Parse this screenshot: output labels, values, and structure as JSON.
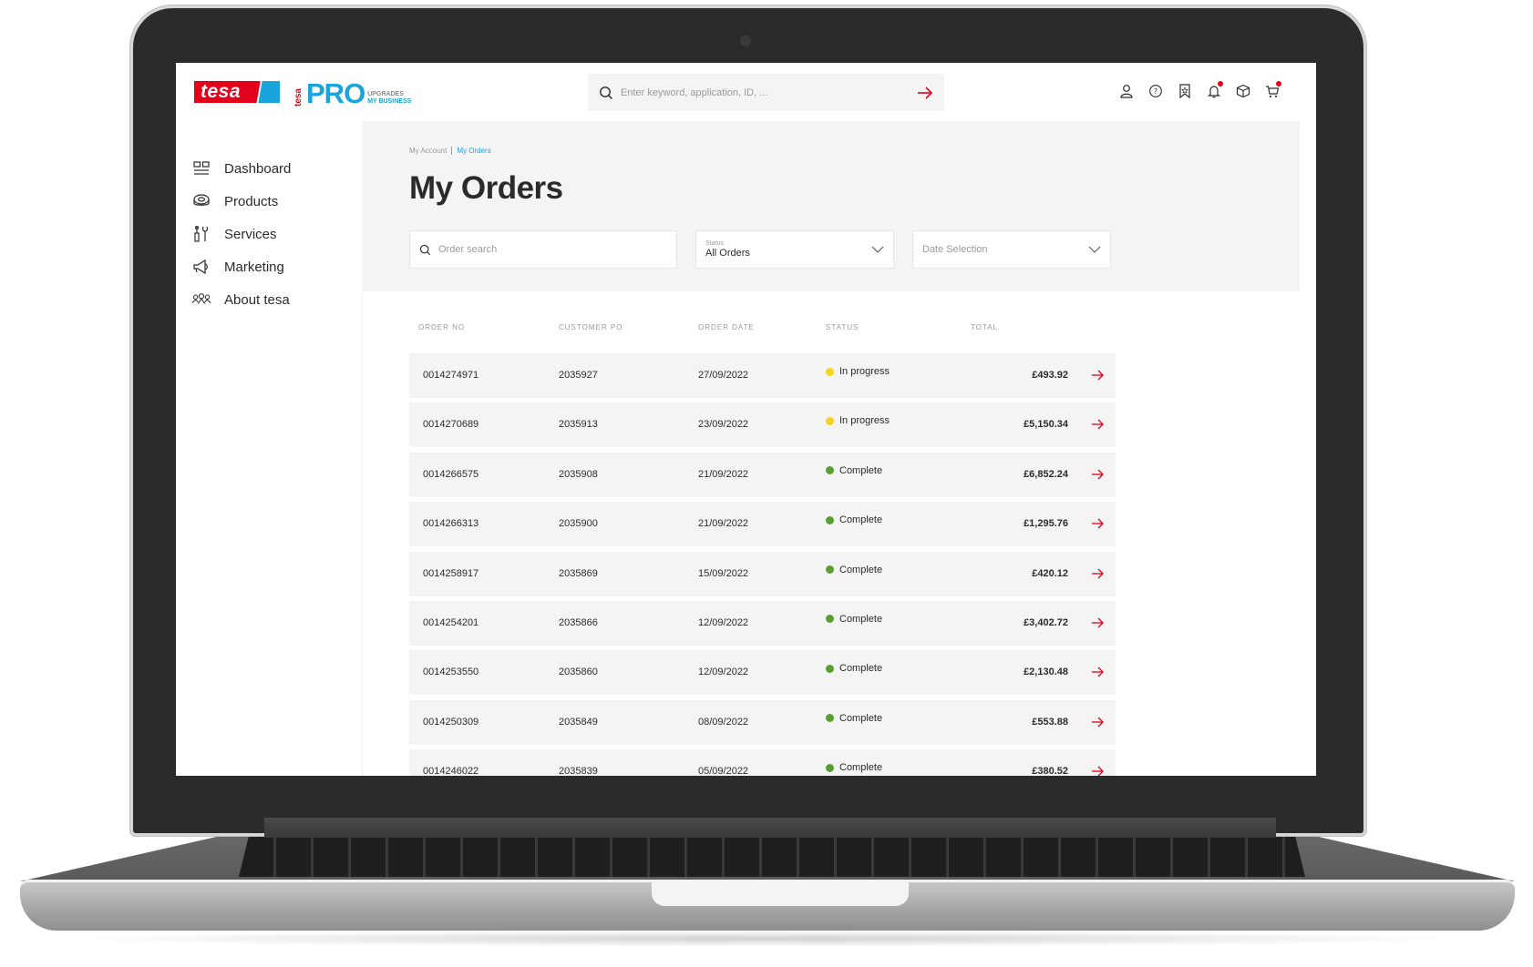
{
  "brand": {
    "logo_text": "tesa",
    "pro_prefix": "tesa",
    "pro_text": "PRO",
    "tagline_1": "UPGRADES",
    "tagline_2": "MY BUSINESS",
    "primary_color": "#e2001a",
    "accent_color": "#1aa3dc"
  },
  "header": {
    "search_placeholder": "Enter keyword, application, ID, ...",
    "search_value": "",
    "icons": [
      "user-icon",
      "help-icon",
      "bookmark-icon",
      "bell-icon",
      "package-icon",
      "cart-icon"
    ],
    "badges": {
      "bell": true,
      "cart": true
    }
  },
  "sidebar": {
    "items": [
      {
        "label": "Dashboard",
        "icon": "dashboard-icon"
      },
      {
        "label": "Products",
        "icon": "tape-roll-icon"
      },
      {
        "label": "Services",
        "icon": "tools-icon"
      },
      {
        "label": "Marketing",
        "icon": "megaphone-icon"
      },
      {
        "label": "About tesa",
        "icon": "people-icon"
      }
    ]
  },
  "breadcrumb": {
    "items": [
      "My Account",
      "My Orders"
    ]
  },
  "page": {
    "title": "My Orders"
  },
  "filters": {
    "search_placeholder": "Order search",
    "search_value": "",
    "status_label": "Status",
    "status_value": "All Orders",
    "date_placeholder": "Date Selection"
  },
  "table": {
    "columns": [
      "ORDER NO",
      "CUSTOMER PO",
      "ORDER DATE",
      "STATUS",
      "TOTAL"
    ],
    "status_colors": {
      "In progress": "#f5d321",
      "Complete": "#5a9e32"
    },
    "rows": [
      {
        "order_no": "0014274971",
        "customer_po": "2035927",
        "order_date": "27/09/2022",
        "status": "In progress",
        "total": "£493.92"
      },
      {
        "order_no": "0014270689",
        "customer_po": "2035913",
        "order_date": "23/09/2022",
        "status": "In progress",
        "total": "£5,150.34"
      },
      {
        "order_no": "0014266575",
        "customer_po": "2035908",
        "order_date": "21/09/2022",
        "status": "Complete",
        "total": "£6,852.24"
      },
      {
        "order_no": "0014266313",
        "customer_po": "2035900",
        "order_date": "21/09/2022",
        "status": "Complete",
        "total": "£1,295.76"
      },
      {
        "order_no": "0014258917",
        "customer_po": "2035869",
        "order_date": "15/09/2022",
        "status": "Complete",
        "total": "£420.12"
      },
      {
        "order_no": "0014254201",
        "customer_po": "2035866",
        "order_date": "12/09/2022",
        "status": "Complete",
        "total": "£3,402.72"
      },
      {
        "order_no": "0014253550",
        "customer_po": "2035860",
        "order_date": "12/09/2022",
        "status": "Complete",
        "total": "£2,130.48"
      },
      {
        "order_no": "0014250309",
        "customer_po": "2035849",
        "order_date": "08/09/2022",
        "status": "Complete",
        "total": "£553.88"
      },
      {
        "order_no": "0014246022",
        "customer_po": "2035839",
        "order_date": "05/09/2022",
        "status": "Complete",
        "total": "£380.52"
      }
    ]
  }
}
